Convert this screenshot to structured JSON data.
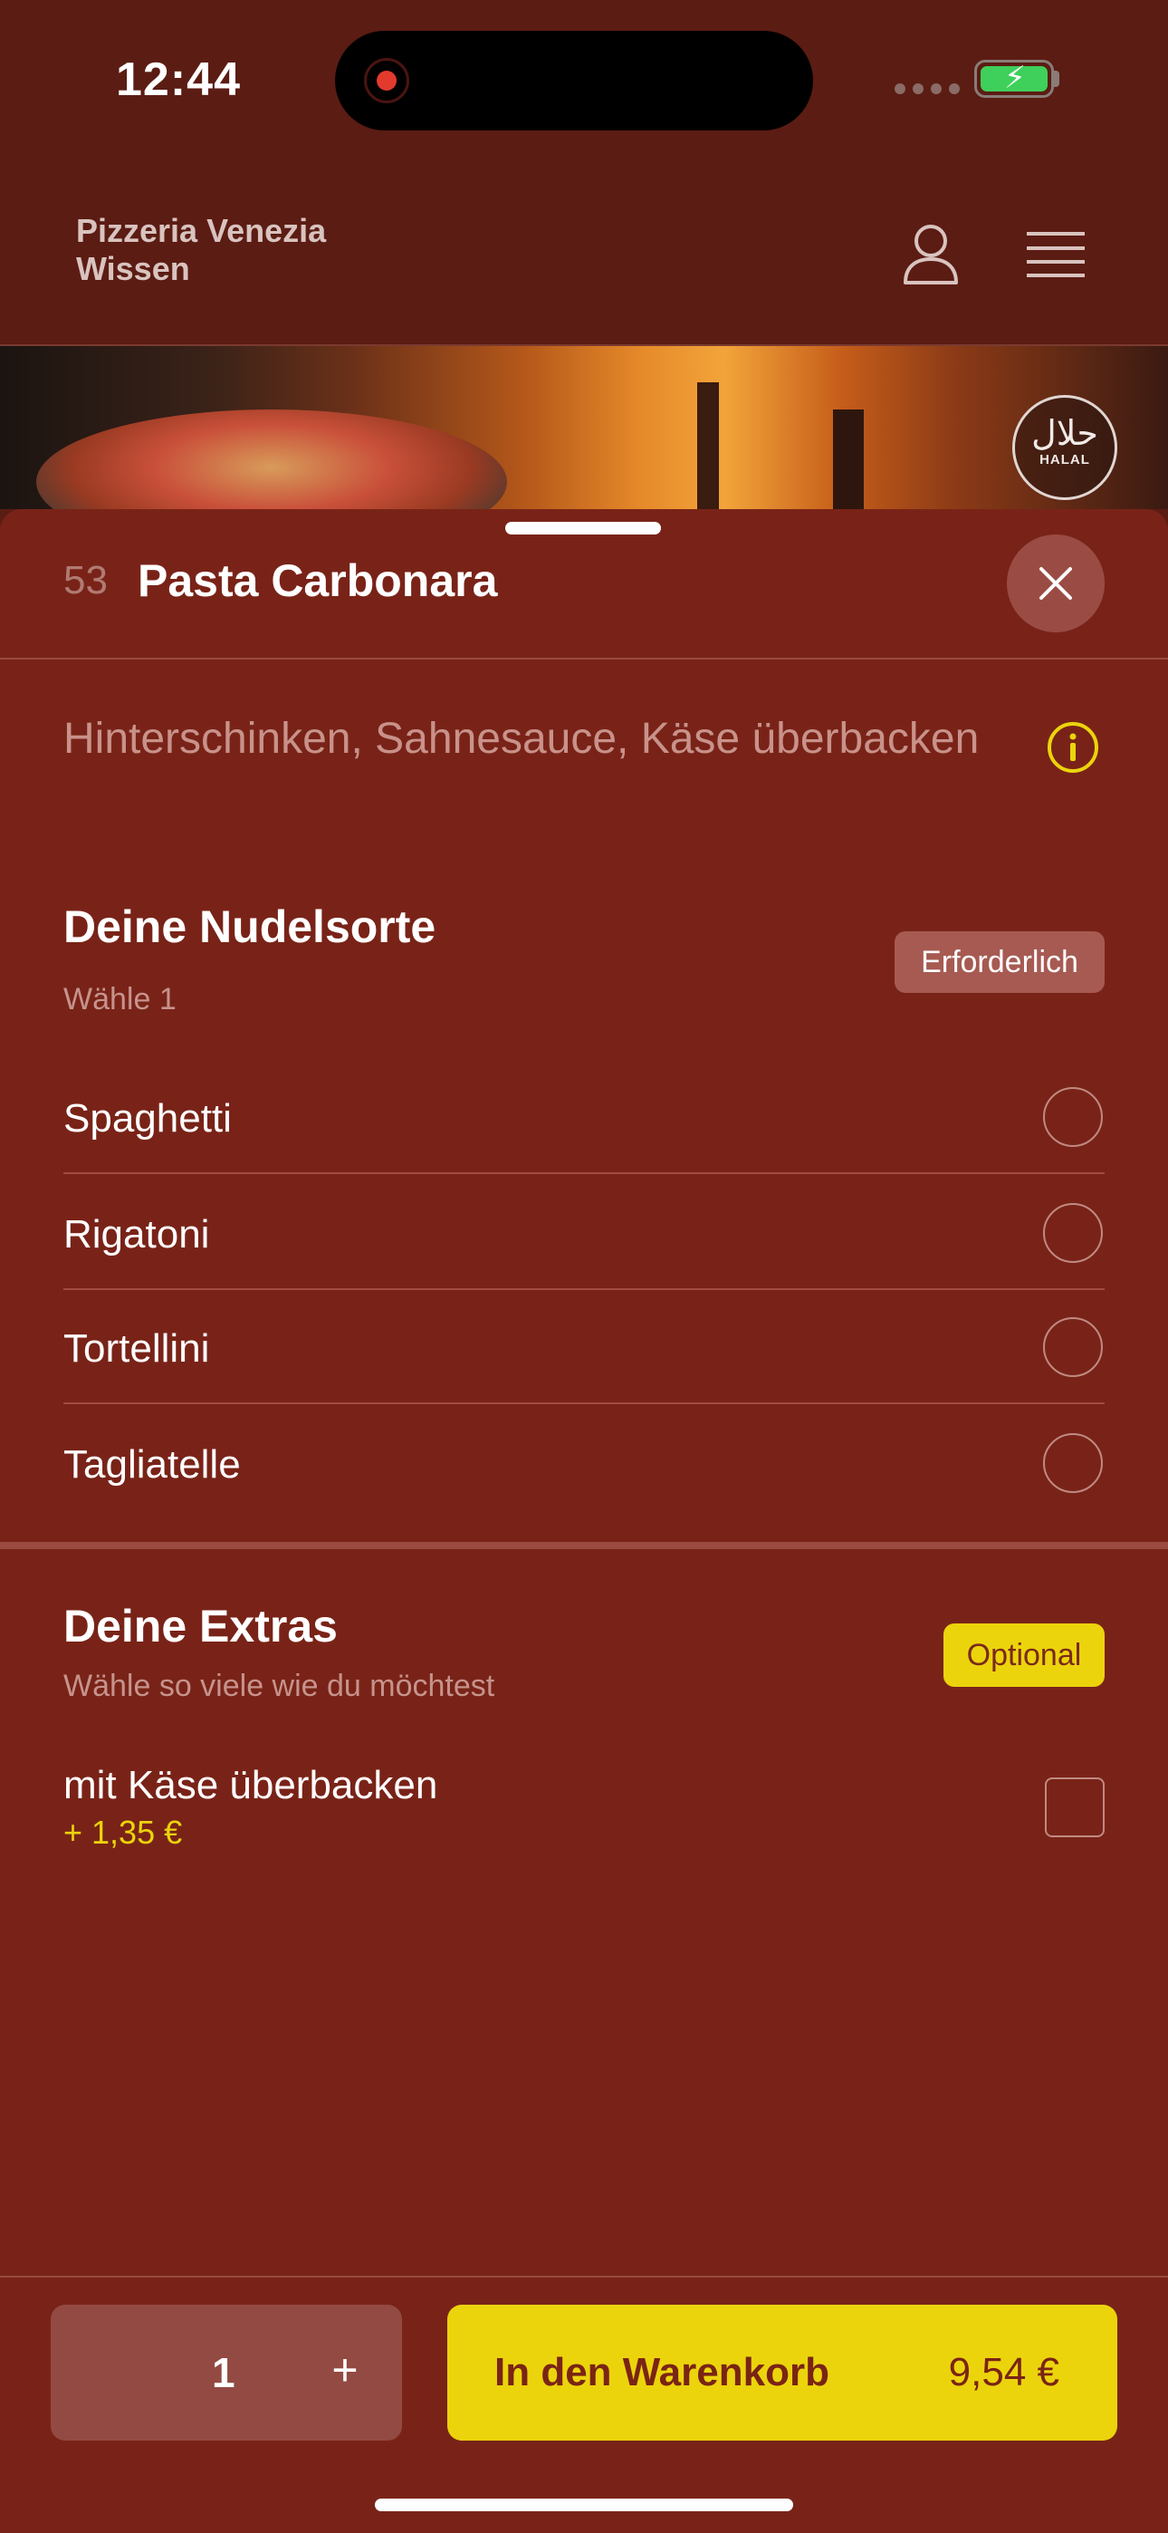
{
  "status": {
    "time": "12:44"
  },
  "header": {
    "brand_line1": "Pizzeria Venezia",
    "brand_line2": "Wissen"
  },
  "halal": {
    "arabic": "حلال",
    "latin": "HALAL"
  },
  "item": {
    "number": "53",
    "title": "Pasta Carbonara",
    "description": "Hinterschinken, Sahnesauce, Käse überbacken"
  },
  "noodles": {
    "title": "Deine Nudelsorte",
    "subtitle": "Wähle 1",
    "badge": "Erforderlich",
    "options": [
      "Spaghetti",
      "Rigatoni",
      "Tortellini",
      "Tagliatelle"
    ]
  },
  "extras": {
    "title": "Deine Extras",
    "subtitle": "Wähle so viele wie du möchtest",
    "badge": "Optional",
    "items": [
      {
        "label": "mit Käse überbacken",
        "price": "+ 1,35 €"
      }
    ]
  },
  "cart": {
    "quantity": "1",
    "plus": "+",
    "button_label": "In den Warenkorb",
    "total": "9,54 €"
  },
  "colors": {
    "accent_yellow": "#ebd40c",
    "sheet_bg": "#792318",
    "header_bg": "#5b1c13"
  }
}
